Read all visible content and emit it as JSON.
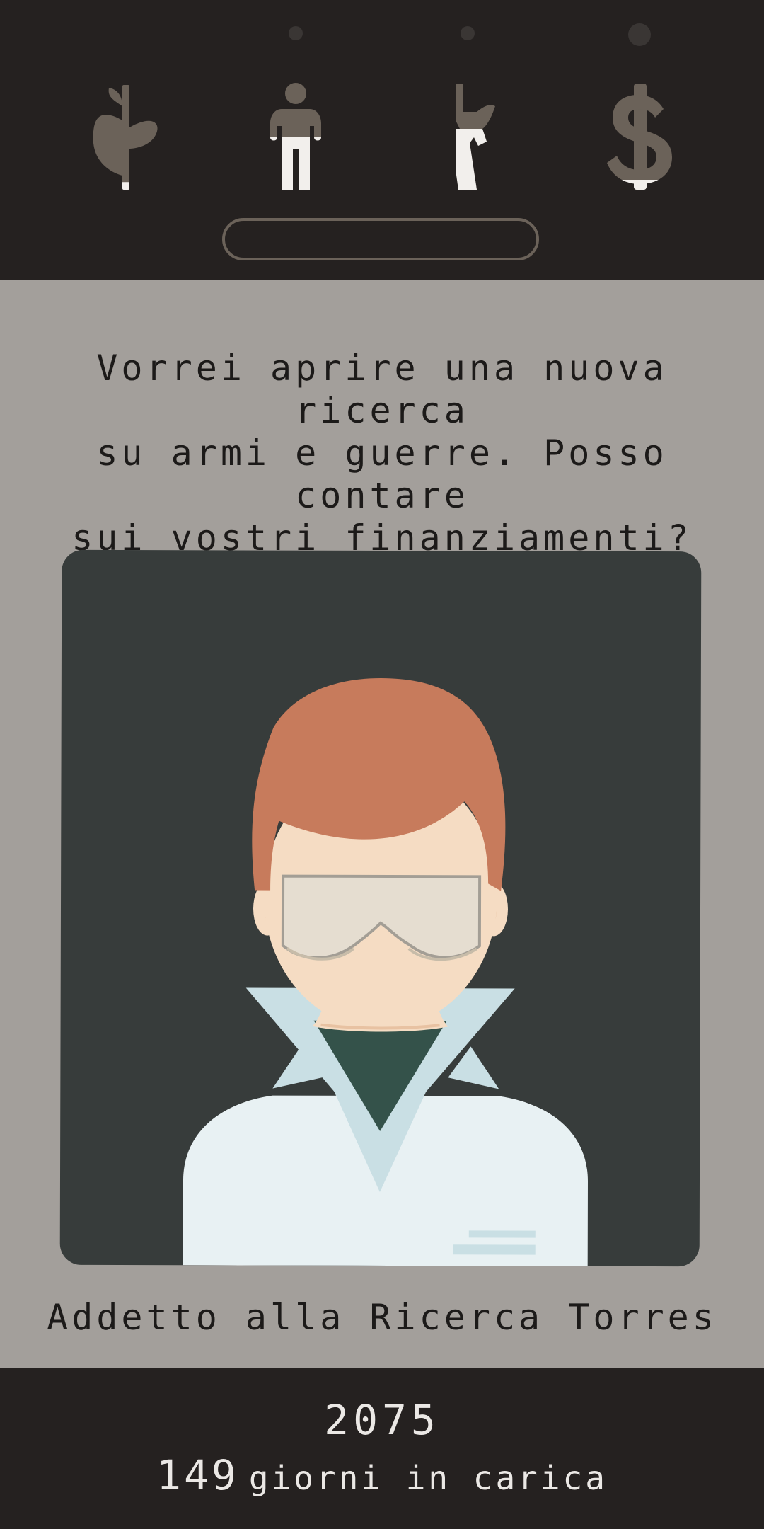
{
  "stats": [
    {
      "id": "religion",
      "icon": "plant-icon",
      "fill_level": 0.08
    },
    {
      "id": "people",
      "icon": "person-icon",
      "fill_level": 0.48
    },
    {
      "id": "military",
      "icon": "rifle-icon",
      "fill_level": 0.55
    },
    {
      "id": "money",
      "icon": "dollar-icon",
      "fill_level": 0.1
    }
  ],
  "question": "Vorrei aprire una nuova ricerca\nsu armi e guerre. Posso contare\nsui vostri finanziamenti?",
  "character": {
    "name": "Addetto alla Ricerca Torres",
    "portrait": "scientist-with-goggles"
  },
  "status": {
    "year": "2075",
    "days_number": "149",
    "days_label": "giorni in carica"
  },
  "colors": {
    "bar_background": "#252120",
    "body_background": "#a39f9b",
    "icon_empty": "#6b6259",
    "icon_filled": "#f2efec",
    "card_background": "#373c3b",
    "hair": "#c77b5c",
    "skin": "#f5dcc3"
  }
}
